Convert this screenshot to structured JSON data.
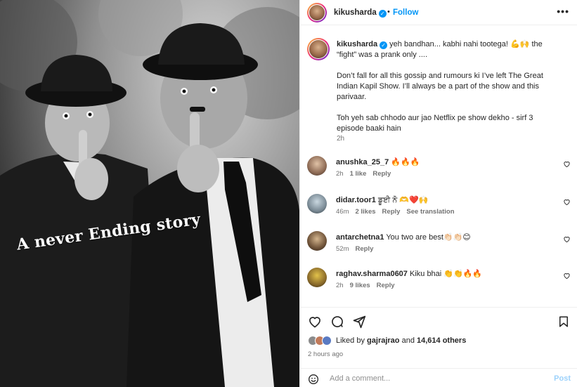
{
  "post": {
    "username": "kikusharda",
    "follow_label": "Follow",
    "more_label": "•••",
    "image_caption": "A never Ending story"
  },
  "caption": {
    "username": "kikusharda",
    "line1": "yeh bandhan... kabhi nahi tootega! 💪🙌 the “fight” was a prank only ....",
    "line2": "Don’t fall for all this gossip and rumours ki I’ve left The Great Indian Kapil Show. I’ll always be a part of the show and this parivaar.",
    "line3": "Toh yeh sab chhodo aur jao Netflix pe show dekho - sirf 3 episode baaki hain",
    "time": "2h"
  },
  "comments": [
    {
      "username": "anushka_25_7",
      "text": "🔥🔥🔥",
      "time": "2h",
      "likes": "1 like",
      "reply": "Reply",
      "translate": ""
    },
    {
      "username": "didar.toor1",
      "text": "ਡੂਈ ਨੋ 🫶❤️🙌",
      "time": "46m",
      "likes": "2 likes",
      "reply": "Reply",
      "translate": "See translation"
    },
    {
      "username": "antarchetna1",
      "text": "You two are best👏🏻👏🏻😊",
      "time": "52m",
      "likes": "",
      "reply": "Reply",
      "translate": ""
    },
    {
      "username": "raghav.sharma0607",
      "text": "Kiku bhai 👏👏🔥🔥",
      "time": "2h",
      "likes": "9 likes",
      "reply": "Reply",
      "translate": ""
    }
  ],
  "likes": {
    "prefix": "Liked by",
    "user": "gajrajrao",
    "conj": "and",
    "others": "14,614 others"
  },
  "posted_time": "2 hours ago",
  "comment_input": {
    "placeholder": "Add a comment...",
    "post_label": "Post"
  },
  "icons": {
    "like": "heart-icon",
    "comment": "comment-icon",
    "share": "send-icon",
    "save": "bookmark-icon",
    "emoji": "smiley-icon",
    "verified": "verified-badge-icon"
  },
  "colors": {
    "accent": "#0095f6",
    "post_disabled": "#9dd2fb",
    "muted": "#737373",
    "text": "#262626"
  }
}
